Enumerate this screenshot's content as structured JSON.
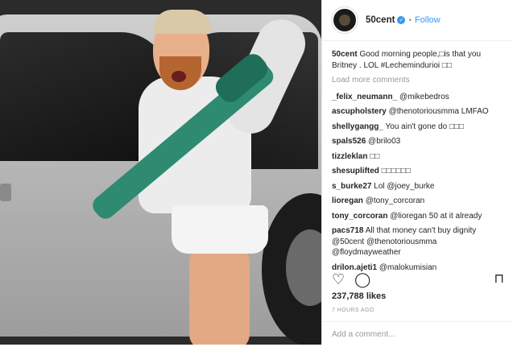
{
  "post": {
    "username": "50cent",
    "follow_label": "Follow",
    "caption_user": "50cent",
    "caption": "Good morning people,□is that you Britney . LOL #Lechemindurioi □□",
    "load_more": "Load more comments",
    "likes": "237,788 likes",
    "time": "7 HOURS AGO",
    "add_comment_placeholder": "Add a comment..."
  },
  "comments": [
    {
      "user": "_felix_neumann_",
      "text": "@mikebedros"
    },
    {
      "user": "ascupholstery",
      "text": "@thenotoriousmma LMFAO"
    },
    {
      "user": "shellygangg_",
      "text": "You ain't gone do □□□"
    },
    {
      "user": "spals526",
      "text": "@brilo03"
    },
    {
      "user": "tizzleklan",
      "text": "□□"
    },
    {
      "user": "shesuplifted",
      "text": "□□□□□□"
    },
    {
      "user": "s_burke27",
      "text": "Lol @joey_burke"
    },
    {
      "user": "lioregan",
      "text": "@tony_corcoran"
    },
    {
      "user": "tony_corcoran",
      "text": "@lioregan 50 at it already"
    },
    {
      "user": "pacs718",
      "text": "All that money can't buy dignity @50cent @thenotoriousmma @floydmayweather"
    },
    {
      "user": "drilon.ajeti1",
      "text": "@malokumisian"
    }
  ],
  "icons": {
    "heart": "heart-icon",
    "comment": "comment-bubble-icon",
    "bookmark": "bookmark-icon",
    "verified": "verified-badge-icon"
  },
  "colors": {
    "link": "#3897f0",
    "text": "#262626",
    "muted": "#999999"
  }
}
